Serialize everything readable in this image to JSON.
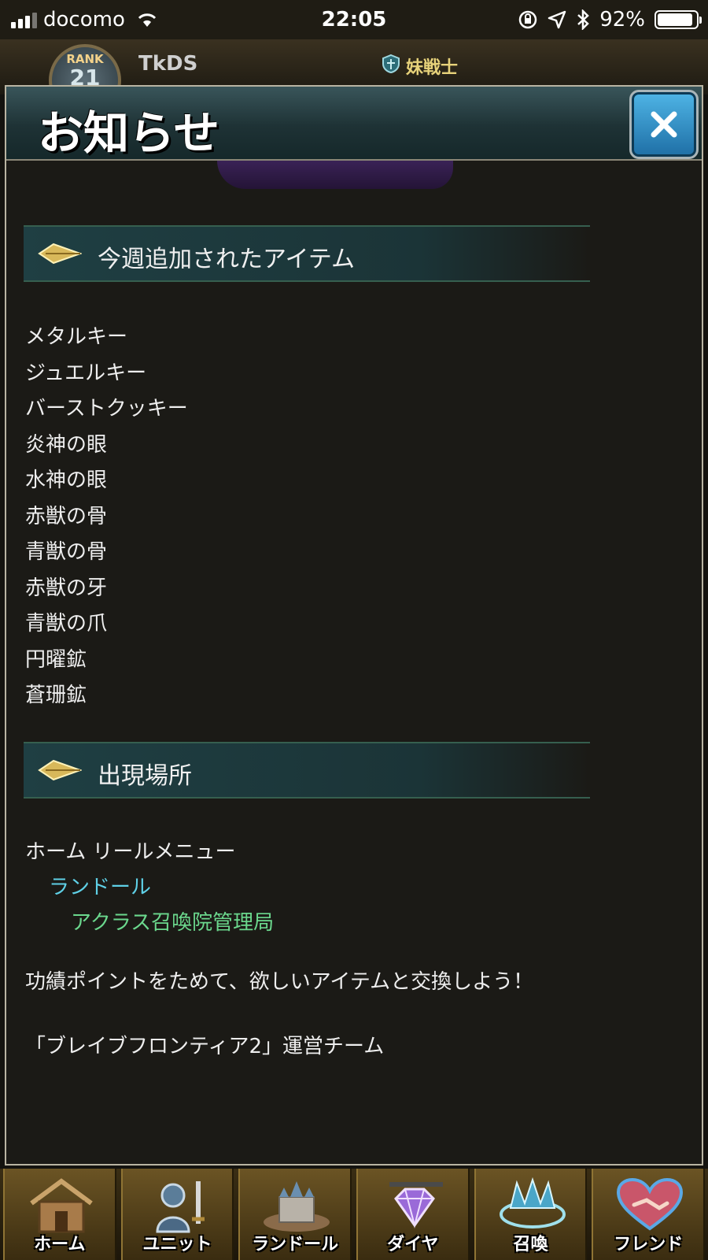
{
  "status_bar": {
    "carrier": "docomo",
    "time": "22:05",
    "battery_percent": "92%",
    "battery_level": 0.92
  },
  "game_header": {
    "rank_label": "RANK",
    "rank_value": "21",
    "player_name": "TkDS",
    "title": "妹戦士"
  },
  "modal": {
    "title": "お知らせ",
    "sections": {
      "items": {
        "heading": "今週追加されたアイテム",
        "entries": [
          "メタルキー",
          "ジュエルキー",
          "バーストクッキー",
          "炎神の眼",
          "水神の眼",
          "赤獣の骨",
          "青獣の骨",
          "赤獣の牙",
          "青獣の爪",
          "円曜鉱",
          "蒼珊鉱"
        ]
      },
      "location": {
        "heading": "出現場所",
        "path": [
          "ホーム リールメニュー",
          "ランドール",
          "アクラス召喚院管理局"
        ]
      }
    },
    "message": "功績ポイントをためて、欲しいアイテムと交換しよう！",
    "signature": "「ブレイブフロンティア2」運営チーム"
  },
  "bottom_nav": {
    "items": [
      {
        "label": "ホーム",
        "icon": "house-icon"
      },
      {
        "label": "ユニット",
        "icon": "knight-icon"
      },
      {
        "label": "ランドール",
        "icon": "castle-icon"
      },
      {
        "label": "ダイヤ",
        "icon": "gem-icon"
      },
      {
        "label": "召喚",
        "icon": "summon-crystal-icon"
      },
      {
        "label": "フレンド",
        "icon": "heart-handshake-icon"
      }
    ]
  },
  "colors": {
    "modal_bg": "#1b1a16",
    "header_teal": "#1e3235",
    "link_cyan": "#5fd0e6",
    "link_green": "#6bd88d",
    "close_blue": "#1e6ea5"
  }
}
